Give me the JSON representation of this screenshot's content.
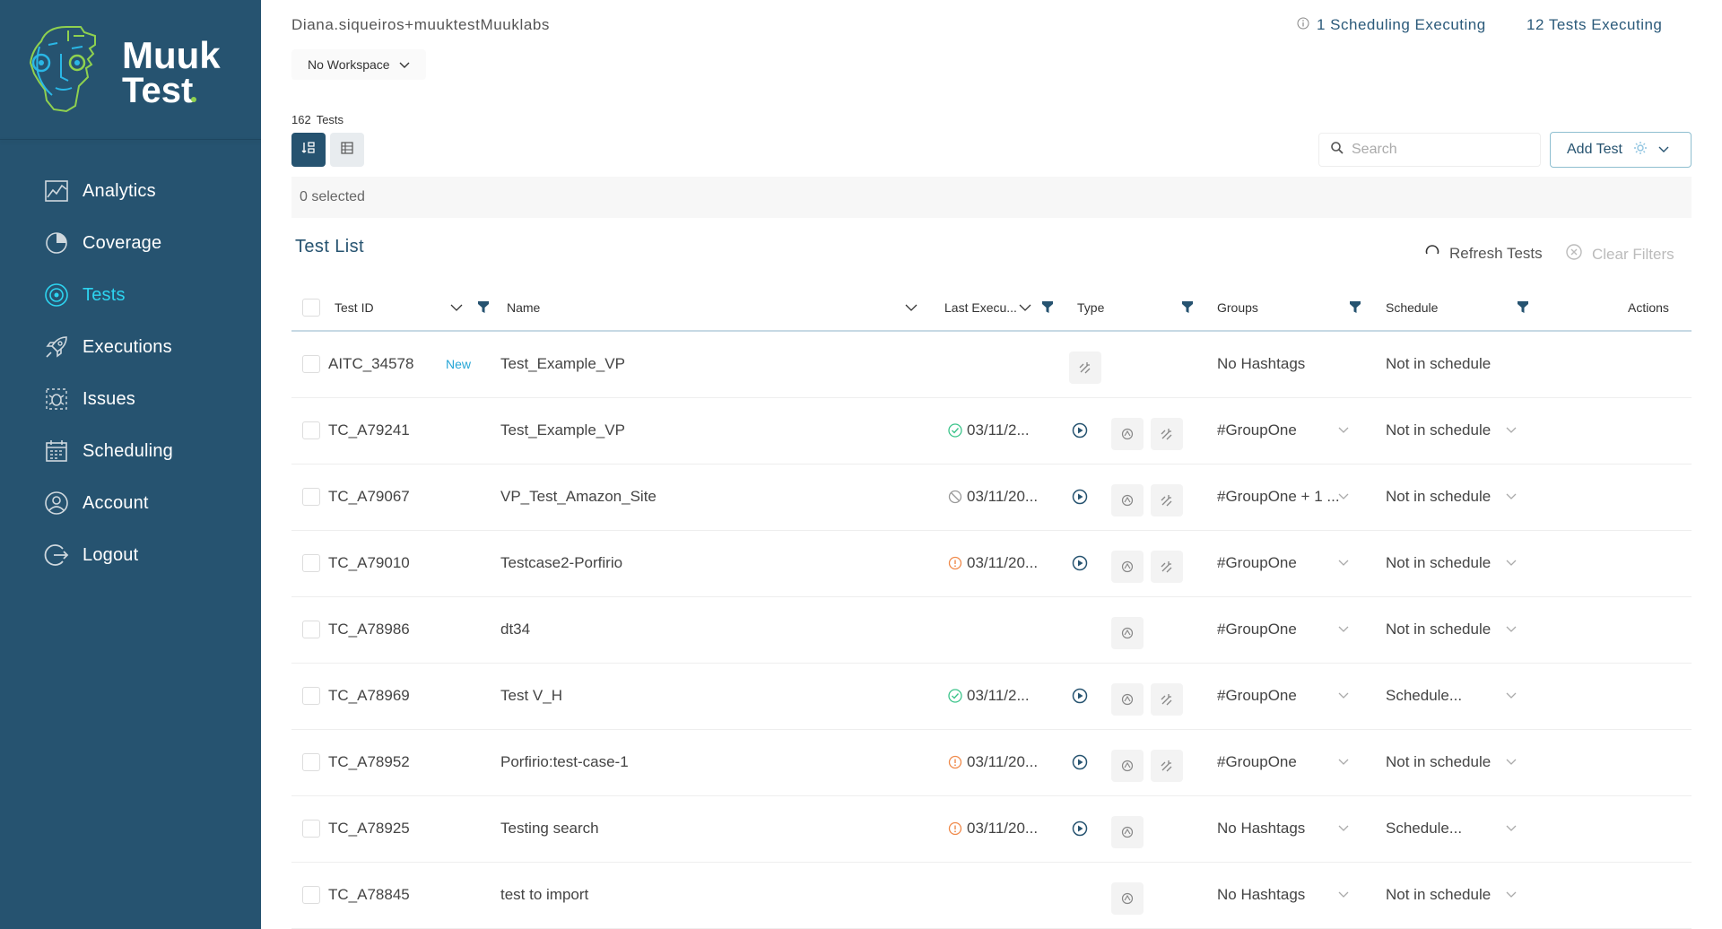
{
  "brand": {
    "name_line1": "Muuk",
    "name_line2": "Test"
  },
  "sidebar": {
    "items": [
      {
        "label": "Analytics",
        "icon": "analytics-icon",
        "active": false
      },
      {
        "label": "Coverage",
        "icon": "coverage-icon",
        "active": false
      },
      {
        "label": "Tests",
        "icon": "tests-icon",
        "active": true
      },
      {
        "label": "Executions",
        "icon": "rocket-icon",
        "active": false
      },
      {
        "label": "Issues",
        "icon": "bug-icon",
        "active": false
      },
      {
        "label": "Scheduling",
        "icon": "calendar-icon",
        "active": false
      },
      {
        "label": "Account",
        "icon": "user-icon",
        "active": false
      },
      {
        "label": "Logout",
        "icon": "logout-icon",
        "active": false
      }
    ]
  },
  "header": {
    "user": "Diana.siqueiros+muuktestMuuklabs",
    "scheduling_status": "1 Scheduling Executing",
    "tests_status": "12 Tests Executing",
    "workspace": "No Workspace"
  },
  "toolbar": {
    "count_number": "162",
    "count_label": "Tests",
    "search_placeholder": "Search",
    "add_test_label": "Add Test",
    "selected_text": "0 selected"
  },
  "list": {
    "title": "Test List",
    "refresh_label": "Refresh Tests",
    "clear_label": "Clear Filters",
    "columns": {
      "test_id": "Test ID",
      "name": "Name",
      "last_exec": "Last Execu...",
      "type": "Type",
      "groups": "Groups",
      "schedule": "Schedule",
      "actions": "Actions"
    }
  },
  "rows": [
    {
      "id": "AITC_34578",
      "badge": "New",
      "name": "Test_Example_VP",
      "status": "",
      "date": "",
      "types": [
        "ai"
      ],
      "group": "No Hashtags",
      "group_dropdown": false,
      "schedule": "Not in schedule",
      "schedule_dropdown": false
    },
    {
      "id": "TC_A79241",
      "badge": "",
      "name": "Test_Example_VP",
      "status": "success",
      "date": "03/11/2...",
      "types": [
        "record",
        "ai"
      ],
      "group": "#GroupOne",
      "group_dropdown": true,
      "schedule": "Not in schedule",
      "schedule_dropdown": true
    },
    {
      "id": "TC_A79067",
      "badge": "",
      "name": "VP_Test_Amazon_Site",
      "status": "cancelled",
      "date": "03/11/20...",
      "types": [
        "record",
        "ai"
      ],
      "group": "#GroupOne + 1 ...",
      "group_dropdown": true,
      "schedule": "Not in schedule",
      "schedule_dropdown": true
    },
    {
      "id": "TC_A79010",
      "badge": "",
      "name": "Testcase2-Porfirio",
      "status": "error",
      "date": "03/11/20...",
      "types": [
        "record",
        "ai"
      ],
      "group": "#GroupOne",
      "group_dropdown": true,
      "schedule": "Not in schedule",
      "schedule_dropdown": true
    },
    {
      "id": "TC_A78986",
      "badge": "",
      "name": "dt34",
      "status": "",
      "date": "",
      "types": [
        "record"
      ],
      "group": "#GroupOne",
      "group_dropdown": true,
      "schedule": "Not in schedule",
      "schedule_dropdown": true
    },
    {
      "id": "TC_A78969",
      "badge": "",
      "name": "Test V_H",
      "status": "success",
      "date": "03/11/2...",
      "types": [
        "record",
        "ai"
      ],
      "group": "#GroupOne",
      "group_dropdown": true,
      "schedule": "Schedule...",
      "schedule_dropdown": true
    },
    {
      "id": "TC_A78952",
      "badge": "",
      "name": "Porfirio:test-case-1",
      "status": "error",
      "date": "03/11/20...",
      "types": [
        "record",
        "ai"
      ],
      "group": "#GroupOne",
      "group_dropdown": true,
      "schedule": "Not in schedule",
      "schedule_dropdown": true
    },
    {
      "id": "TC_A78925",
      "badge": "",
      "name": "Testing search",
      "status": "error",
      "date": "03/11/20...",
      "types": [
        "record"
      ],
      "group": "No Hashtags",
      "group_dropdown": true,
      "schedule": "Schedule...",
      "schedule_dropdown": true
    },
    {
      "id": "TC_A78845",
      "badge": "",
      "name": "test to import",
      "status": "",
      "date": "",
      "types": [
        "record"
      ],
      "group": "No Hashtags",
      "group_dropdown": true,
      "schedule": "Not in schedule",
      "schedule_dropdown": true
    }
  ],
  "colors": {
    "sidebar_bg": "#265370",
    "active_nav": "#2dd4f0",
    "success": "#3cc48b",
    "error": "#f08a4b",
    "cancelled": "#999999",
    "badge_new": "#26a6d6"
  }
}
